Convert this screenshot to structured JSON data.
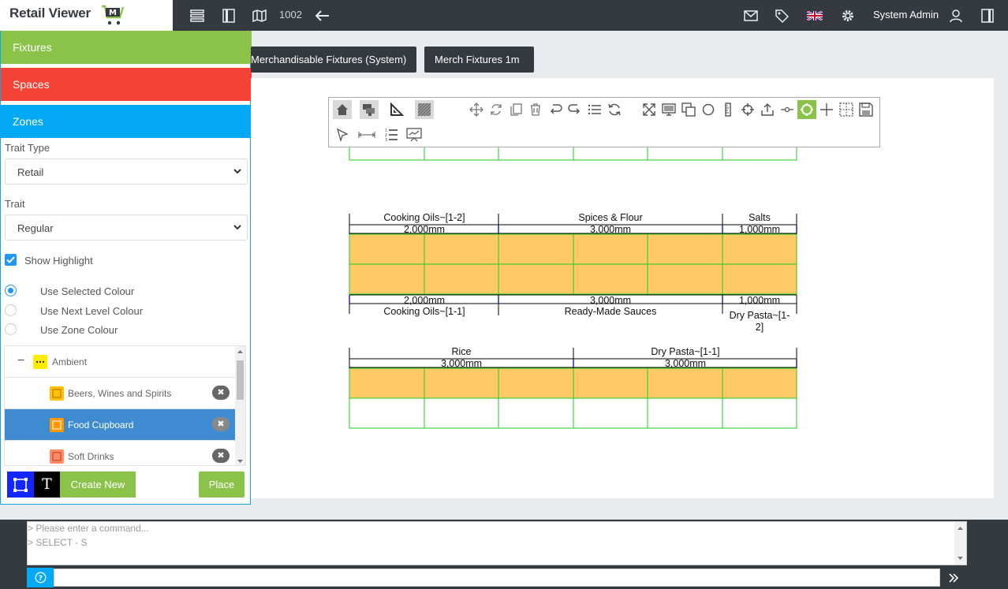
{
  "app": {
    "logo_text": "Retail Viewer",
    "logo_badge": "M"
  },
  "topbar": {
    "store_code": "1002",
    "user_name": "System Admin",
    "icons": [
      "list-icon",
      "panel-icon",
      "map-icon",
      "back-arrow-icon",
      "mail-icon",
      "tag-icon",
      "uk-flag-icon",
      "gear-icon",
      "user-icon",
      "sidebar-toggle-icon"
    ]
  },
  "left_panel": {
    "accordion": {
      "fixtures": "Fixtures",
      "spaces": "Spaces",
      "zones": "Zones"
    },
    "trait_type": {
      "label": "Trait Type",
      "value": "Retail"
    },
    "trait": {
      "label": "Trait",
      "value": "Regular"
    },
    "show_highlight": {
      "label": "Show Highlight",
      "checked": true
    },
    "colour_options": [
      {
        "label": "Use Selected Colour",
        "selected": true
      },
      {
        "label": "Use Next Level Colour",
        "selected": false
      },
      {
        "label": "Use Zone Colour",
        "selected": false
      }
    ],
    "tree": {
      "root": {
        "label": "Ambient",
        "toggle": "−",
        "colour": "#ffeb00"
      },
      "items": [
        {
          "label": "Beers, Wines and Spirits",
          "colour": "#ffc107",
          "selected": false
        },
        {
          "label": "Food Cupboard",
          "colour": "#ff9800",
          "selected": true
        },
        {
          "label": "Soft Drinks",
          "colour": "#ff8a65",
          "selected": false
        }
      ],
      "remove_glyph": "✖"
    },
    "buttons": {
      "text_tool": "T",
      "create_new": "Create New",
      "place": "Place"
    }
  },
  "tabs": [
    {
      "label": "Merchandisable Fixtures (System)"
    },
    {
      "label": "Merch Fixtures 1m"
    }
  ],
  "plan": {
    "cell_fill": "#ffc966",
    "grid_color": "#22cc22",
    "row1": {
      "labels": [
        "Cooking Oils~[1-2]",
        "Spices & Flour",
        "Salts"
      ],
      "dims": [
        "2,000mm",
        "3,000mm",
        "1,000mm"
      ]
    },
    "row2": {
      "dims": [
        "2,000mm",
        "3,000mm",
        "1,000mm"
      ],
      "labels": [
        "Cooking Oils~[1-1]",
        "Ready-Made Sauces",
        "Dry Pasta~[1-",
        "2]"
      ]
    },
    "row3": {
      "labels": [
        "Rice",
        "Dry Pasta~[1-1]"
      ],
      "dims": [
        "3,000mm",
        "3,000mm"
      ]
    }
  },
  "command": {
    "placeholder": "> Please enter a command...",
    "last_command": "> SELECT - S"
  },
  "colors": {
    "dark": "#343a40",
    "green": "#8bc34a",
    "red": "#f44336",
    "blue": "#03a9f4",
    "selection": "#3f8bd1"
  }
}
